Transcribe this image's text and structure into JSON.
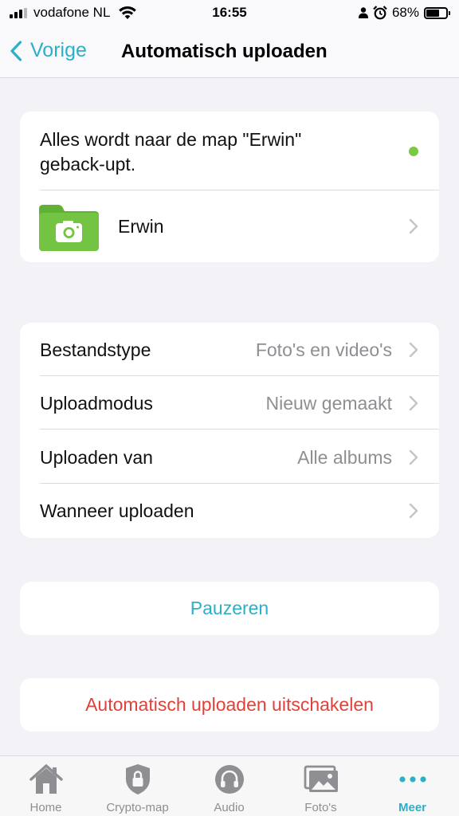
{
  "status_bar": {
    "carrier": "vodafone NL",
    "time": "16:55",
    "battery_percent": "68%",
    "battery_level": 0.68
  },
  "nav": {
    "back_label": "Vorige",
    "title": "Automatisch uploaden"
  },
  "info_card": {
    "message": "Alles wordt naar de map \"Erwin\" geback-upt.",
    "status_color": "#7ac943",
    "folder_name": "Erwin",
    "folder_color": "#6cbf3a"
  },
  "settings": [
    {
      "label": "Bestandstype",
      "value": "Foto's en video's"
    },
    {
      "label": "Uploadmodus",
      "value": "Nieuw gemaakt"
    },
    {
      "label": "Uploaden van",
      "value": "Alle albums"
    },
    {
      "label": "Wanneer uploaden",
      "value": ""
    }
  ],
  "actions": {
    "pause_label": "Pauzeren",
    "disable_label": "Automatisch uploaden uitschakelen"
  },
  "tab_bar": {
    "active": "Meer",
    "accent_color": "#2bb0c7",
    "tabs": [
      {
        "label": "Home",
        "icon": "home-icon"
      },
      {
        "label": "Crypto-map",
        "icon": "lock-shield-icon"
      },
      {
        "label": "Audio",
        "icon": "headphones-icon"
      },
      {
        "label": "Foto's",
        "icon": "photos-icon"
      },
      {
        "label": "Meer",
        "icon": "more-dots-icon"
      }
    ]
  }
}
